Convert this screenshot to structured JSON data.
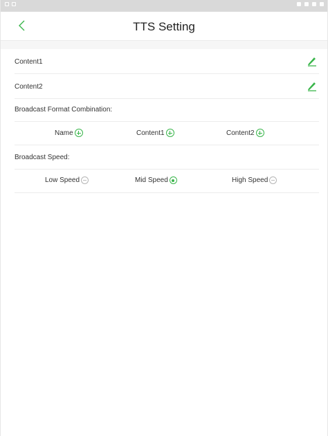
{
  "header": {
    "title": "TTS Setting"
  },
  "content_rows": [
    {
      "label": "Content1"
    },
    {
      "label": "Content2"
    }
  ],
  "broadcast_format": {
    "label": "Broadcast Format Combination:",
    "items": [
      {
        "label": "Name"
      },
      {
        "label": "Content1"
      },
      {
        "label": "Content2"
      }
    ]
  },
  "broadcast_speed": {
    "label": "Broadcast Speed:",
    "options": [
      {
        "label": "Low Speed",
        "selected": false
      },
      {
        "label": "Mid Speed",
        "selected": true
      },
      {
        "label": "High Speed",
        "selected": false
      }
    ]
  },
  "colors": {
    "accent": "#39b54a",
    "divider": "#ececec",
    "statusbar": "#d9d9d9"
  },
  "icons": {
    "back": "chevron-left-icon",
    "edit": "pencil-icon",
    "add": "plus-circle-icon",
    "radio": "radio-icon"
  }
}
